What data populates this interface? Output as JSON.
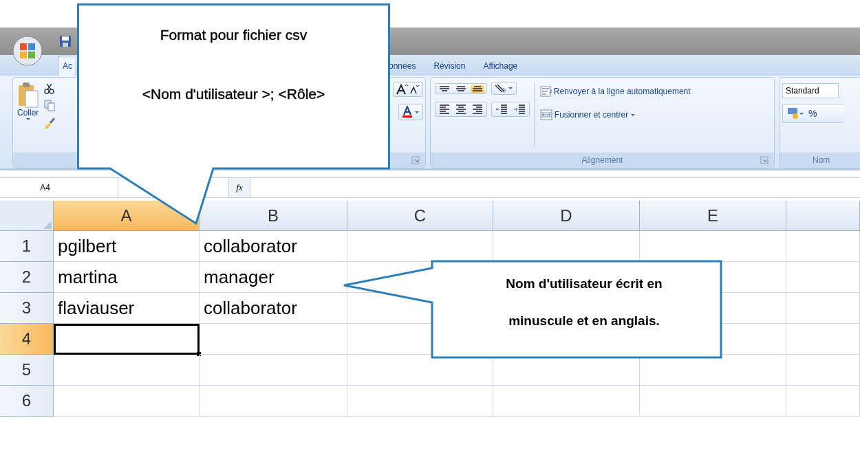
{
  "ribbon_tabs": [
    {
      "label": "Ac",
      "selected": true
    },
    {
      "label": "onnées",
      "selected": false
    },
    {
      "label": "Révision",
      "selected": false
    },
    {
      "label": "Affichage",
      "selected": false
    }
  ],
  "ribbon": {
    "clipboard": {
      "paste_label": "Coller"
    },
    "alignment": {
      "vertical_buttons": [
        {
          "kind": "top",
          "selected": false
        },
        {
          "kind": "middle",
          "selected": false
        },
        {
          "kind": "bottom",
          "selected": true
        }
      ],
      "wrap_text": "Renvoyer à la ligne automatiquement",
      "merge": "Fusionner et centrer",
      "label": "Alignement"
    },
    "number": {
      "format": "Standard",
      "percent": "%",
      "label": "Nom"
    }
  },
  "formula_bar": {
    "name_box": "A4",
    "function_label": "fx"
  },
  "sheet": {
    "columns": [
      {
        "label": "A",
        "selected": true
      },
      {
        "label": "B",
        "selected": false
      },
      {
        "label": "C",
        "selected": false
      },
      {
        "label": "D",
        "selected": false
      },
      {
        "label": "E",
        "selected": false
      }
    ],
    "rows": [
      {
        "label": "1",
        "selected": false,
        "cells": [
          {
            "text": "pgilbert",
            "selected": false
          },
          {
            "text": "collaborator",
            "selected": false
          }
        ]
      },
      {
        "label": "2",
        "selected": false,
        "cells": [
          {
            "text": "martina",
            "selected": false
          },
          {
            "text": "manager",
            "selected": false
          }
        ]
      },
      {
        "label": "3",
        "selected": false,
        "cells": [
          {
            "text": "flaviauser",
            "selected": false
          },
          {
            "text": "collaborator",
            "selected": false
          }
        ]
      },
      {
        "label": "4",
        "selected": true,
        "cells": [
          {
            "selected": true
          }
        ]
      },
      {
        "label": "5",
        "selected": false,
        "cells": []
      },
      {
        "label": "6",
        "selected": false,
        "cells": []
      }
    ]
  },
  "callouts": [
    {
      "kind": "down",
      "lines": [
        "Format pour fichier csv",
        "<Nom d'utilisateur >; <Rôle>"
      ]
    },
    {
      "kind": "left",
      "lines": [
        "Nom d'utilisateur écrit en",
        "minuscule et en anglais."
      ]
    }
  ]
}
